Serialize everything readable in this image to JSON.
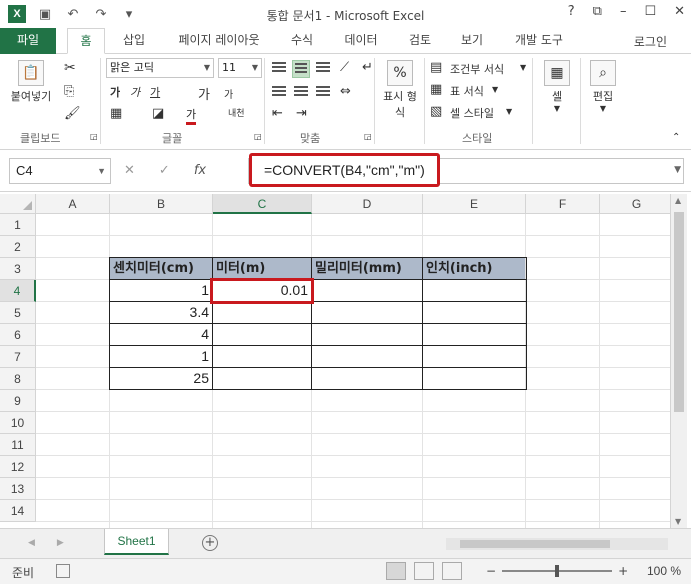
{
  "window": {
    "title": "통합 문서1 - Microsoft Excel",
    "controls": [
      "?",
      "⧉",
      "–",
      "☐",
      "✕"
    ]
  },
  "quick_access": {
    "app_icon": "X",
    "icons": [
      "save-icon",
      "undo-icon",
      "redo-icon",
      "customize-icon"
    ]
  },
  "ribbon_tabs": {
    "file": "파일",
    "items": [
      "홈",
      "삽입",
      "페이지 레이아웃",
      "수식",
      "데이터",
      "검토",
      "보기",
      "개발 도구"
    ],
    "active": "홈",
    "user": "로그인"
  },
  "ribbon": {
    "clipboard": {
      "label": "클립보드",
      "paste": "붙여넣기"
    },
    "font": {
      "label": "글꼴",
      "font_name": "맑은 고딕",
      "font_size": "11",
      "bold": "가",
      "italic": "가",
      "underline": "가",
      "grow": "가",
      "shrink": "가",
      "color": "가",
      "phonetic": "내천"
    },
    "alignment": {
      "label": "맞춤"
    },
    "number": {
      "label": "표시 형식",
      "line1": "표시 형",
      "line2": "식",
      "percent": "%"
    },
    "styles": {
      "label": "스타일",
      "conditional": "조건부 서식",
      "table": "표 서식",
      "cell_styles": "셀 스타일"
    },
    "cells": {
      "label": "셀"
    },
    "editing": {
      "label": "편집"
    }
  },
  "formula_bar": {
    "name_box": "C4",
    "fx": "fx",
    "formula": "=CONVERT(B4,\"cm\",\"m\")"
  },
  "grid": {
    "columns": [
      "A",
      "B",
      "C",
      "D",
      "E",
      "F",
      "G"
    ],
    "rows": [
      "1",
      "2",
      "3",
      "4",
      "5",
      "6",
      "7",
      "8",
      "9",
      "10",
      "11",
      "12",
      "13",
      "14"
    ],
    "selected_cell": "C4",
    "table": {
      "headers": [
        "센치미터(cm)",
        "미터(m)",
        "밀리미터(mm)",
        "인치(inch)"
      ],
      "rows": [
        [
          "1",
          "0.01",
          "",
          ""
        ],
        [
          "3.4",
          "",
          "",
          ""
        ],
        [
          "4",
          "",
          "",
          ""
        ],
        [
          "1",
          "",
          "",
          ""
        ],
        [
          "25",
          "",
          "",
          ""
        ]
      ]
    }
  },
  "sheets": {
    "tabs": [
      "Sheet1"
    ],
    "active": "Sheet1",
    "add": "+"
  },
  "status": {
    "text": "준비",
    "zoom": "100 %",
    "zoom_level": 100
  },
  "colors": {
    "excel_green": "#217346",
    "header_fill": "#adb9ca",
    "highlight_red": "#c9191e"
  }
}
